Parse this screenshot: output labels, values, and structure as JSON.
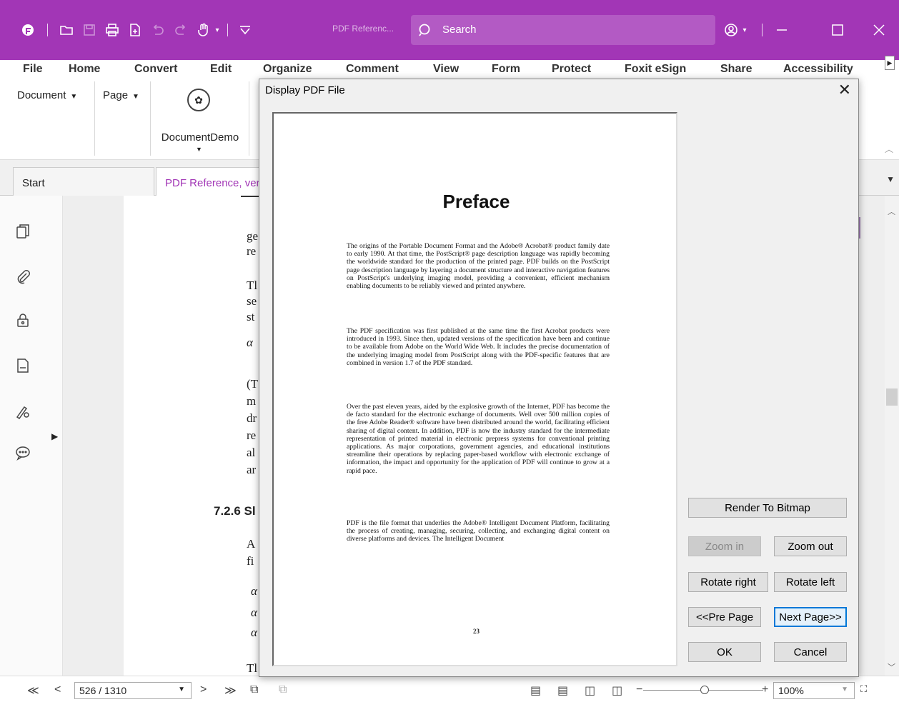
{
  "titlebar": {
    "doc_title": "PDF Referenc...",
    "search_placeholder": "Search",
    "color": "#a236b6"
  },
  "menu": [
    "File",
    "Home",
    "Convert",
    "Edit",
    "Organize",
    "Comment",
    "View",
    "Form",
    "Protect",
    "Foxit eSign",
    "Share",
    "Accessibility"
  ],
  "ribbon": {
    "document_label": "Document",
    "page_label": "Page",
    "plugin_label": "DocumentDemo"
  },
  "tabs": {
    "start": "Start",
    "active": "PDF Reference, vers"
  },
  "page_fragments": {
    "l1": "ge",
    "l2": "re",
    "l3": "Tl",
    "l4": "se",
    "l5": "st",
    "l6": "α",
    "l7": "(T",
    "l8": "m",
    "l9": "dr",
    "l10": "re",
    "l11": "al",
    "l12": "ar",
    "section": "7.2.6  Sl",
    "l13": "A",
    "l14": "fi",
    "l15": "α",
    "l16": "α",
    "l17": "α",
    "l18": "Tl"
  },
  "status": {
    "page_value": "526 / 1310",
    "zoom_value": "100%"
  },
  "dialog": {
    "title": "Display PDF File",
    "preview": {
      "heading": "Preface",
      "paragraphs": [
        "The origins of the Portable Document Format and the Adobe® Acrobat® product family date to early 1990. At that time, the PostScript® page description language was rapidly becoming the worldwide standard for the production of the printed page. PDF builds on the PostScript page description language by layering a document structure and interactive navigation features on PostScript's underlying imaging model, providing a convenient, efficient mechanism enabling documents to be reliably viewed and printed anywhere.",
        "The PDF specification was first published at the same time the first Acrobat products were introduced in 1993. Since then, updated versions of the specification have been and continue to be available from Adobe on the World Wide Web. It includes the precise documentation of the underlying imaging model from PostScript along with the PDF-specific features that are combined in version 1.7 of the PDF standard.",
        "Over the past eleven years, aided by the explosive growth of the Internet, PDF has become the de facto standard for the electronic exchange of documents. Well over 500 million copies of the free Adobe Reader® software have been distributed around the world, facilitating efficient sharing of digital content. In addition, PDF is now the industry standard for the intermediate representation of printed material in electronic prepress systems for conventional printing applications. As major corporations, government agencies, and educational institutions streamline their operations by replacing paper-based workflow with electronic exchange of information, the impact and opportunity for the application of PDF will continue to grow at a rapid pace.",
        "PDF is the file format that underlies the Adobe® Intelligent Document Platform, facilitating the process of creating, managing, securing, collecting, and exchanging digital content on diverse platforms and devices. The Intelligent Document"
      ],
      "page_number": "23"
    },
    "buttons": {
      "render": "Render To Bitmap",
      "zoom_in": "Zoom in",
      "zoom_out": "Zoom out",
      "rotate_right": "Rotate right",
      "rotate_left": "Rotate left",
      "pre_page": "<<Pre Page",
      "next_page": "Next Page>>",
      "ok": "OK",
      "cancel": "Cancel"
    }
  }
}
